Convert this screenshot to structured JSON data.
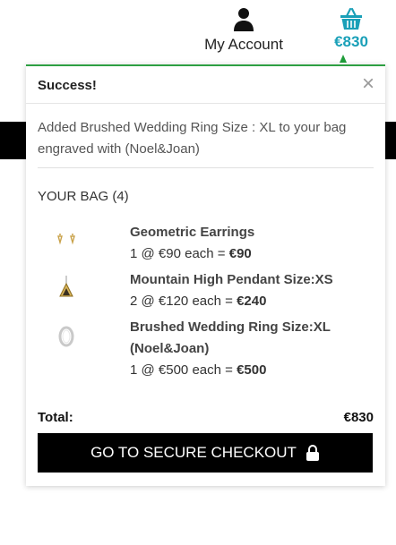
{
  "header": {
    "account_label": "My Account",
    "cart_amount": "€830",
    "account_icon": "user-icon",
    "cart_icon": "basket-icon"
  },
  "popup": {
    "title": "Success!",
    "close_glyph": "×",
    "message": "Added Brushed Wedding Ring Size : XL to your bag engraved with (Noel&Joan)",
    "bag_title": "YOUR BAG (4)",
    "items": [
      {
        "name": "Geometric Earrings",
        "qty_text": "1 @ €90 each =",
        "subtotal": "€90",
        "thumb": "earrings-thumbnail"
      },
      {
        "name": "Mountain High Pendant Size:XS",
        "qty_text": "2 @ €120 each =",
        "subtotal": "€240",
        "thumb": "pendant-thumbnail"
      },
      {
        "name": "Brushed Wedding Ring Size:XL (Noel&Joan)",
        "qty_text": "1 @ €500 each =",
        "subtotal": "€500",
        "thumb": "ring-thumbnail"
      }
    ],
    "total_label": "Total:",
    "total_amount": "€830",
    "checkout_label": "GO TO SECURE CHECKOUT",
    "checkout_icon": "lock-icon"
  },
  "colors": {
    "accent": "#1aa0b8",
    "success": "#2ea043",
    "button_bg": "#000000"
  }
}
